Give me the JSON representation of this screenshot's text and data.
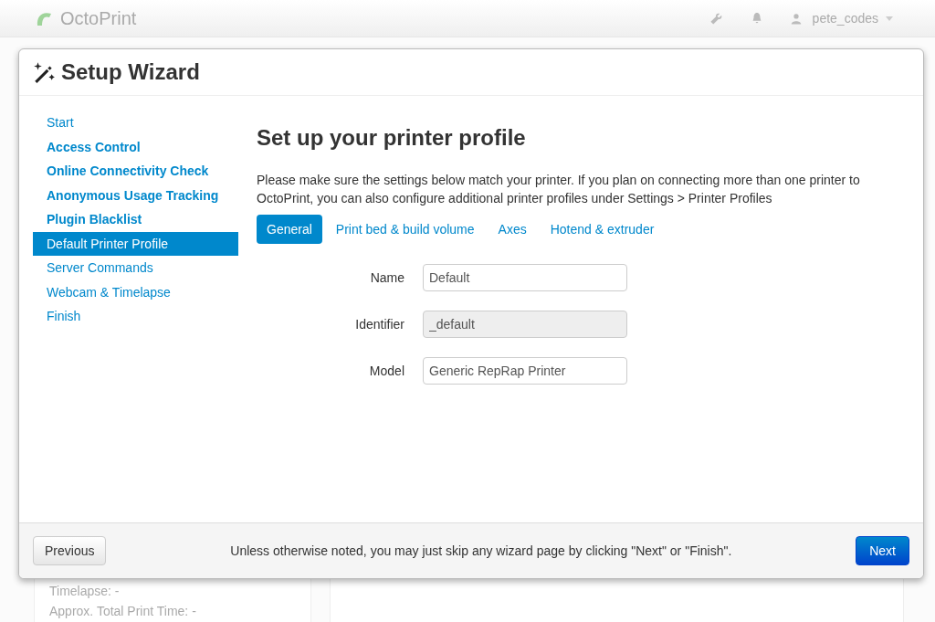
{
  "navbar": {
    "brand": "OctoPrint",
    "user": "pete_codes"
  },
  "background": {
    "lines": [
      "Timelapse: -",
      "Approx. Total Print Time: -"
    ]
  },
  "dialog": {
    "title": "Setup Wizard",
    "steps": [
      {
        "label": "Start",
        "emphasized": false,
        "selected": false
      },
      {
        "label": "Access Control",
        "emphasized": true,
        "selected": false
      },
      {
        "label": "Online Connectivity Check",
        "emphasized": true,
        "selected": false
      },
      {
        "label": "Anonymous Usage Tracking",
        "emphasized": true,
        "selected": false
      },
      {
        "label": "Plugin Blacklist",
        "emphasized": true,
        "selected": false
      },
      {
        "label": "Default Printer Profile",
        "emphasized": false,
        "selected": true
      },
      {
        "label": "Server Commands",
        "emphasized": false,
        "selected": false
      },
      {
        "label": "Webcam & Timelapse",
        "emphasized": false,
        "selected": false
      },
      {
        "label": "Finish",
        "emphasized": false,
        "selected": false
      }
    ],
    "heading": "Set up your printer profile",
    "intro": "Please make sure the settings below match your printer. If you plan on connecting more than one printer to OctoPrint, you can also configure additional printer profiles under Settings > Printer Profiles",
    "tabs": [
      {
        "label": "General",
        "selected": true
      },
      {
        "label": "Print bed & build volume",
        "selected": false
      },
      {
        "label": "Axes",
        "selected": false
      },
      {
        "label": "Hotend & extruder",
        "selected": false
      }
    ],
    "fields": [
      {
        "label": "Name",
        "value": "Default",
        "disabled": false
      },
      {
        "label": "Identifier",
        "value": "_default",
        "disabled": true
      },
      {
        "label": "Model",
        "value": "Generic RepRap Printer",
        "disabled": false
      }
    ],
    "footer": {
      "previous": "Previous",
      "note": "Unless otherwise noted, you may just skip any wizard page by clicking \"Next\" or \"Finish\".",
      "next": "Next"
    }
  }
}
